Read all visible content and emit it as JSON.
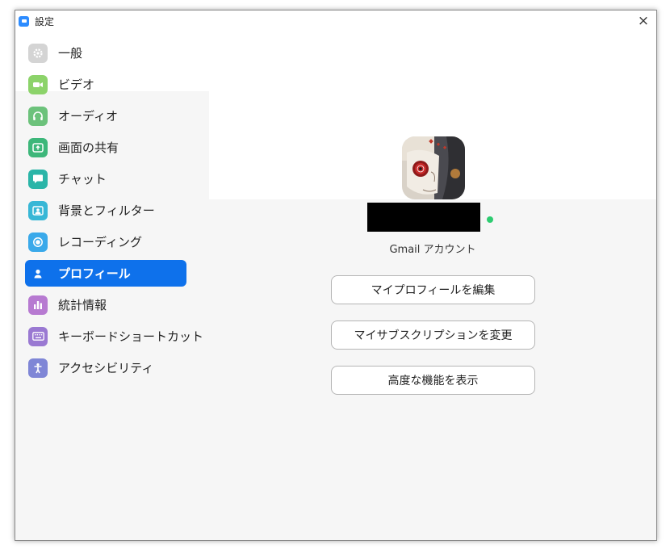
{
  "window": {
    "title": "設定",
    "close_label": "×"
  },
  "sidebar": {
    "items": [
      {
        "label": "一般",
        "icon": "gear-icon",
        "color": "#cfcfcf"
      },
      {
        "label": "ビデオ",
        "icon": "video-camera-icon",
        "color": "#8cd36a"
      },
      {
        "label": "オーディオ",
        "icon": "headphones-icon",
        "color": "#6cc27b"
      },
      {
        "label": "画面の共有",
        "icon": "share-screen-icon",
        "color": "#3db77a"
      },
      {
        "label": "チャット",
        "icon": "chat-bubble-icon",
        "color": "#2bb5a8"
      },
      {
        "label": "背景とフィルター",
        "icon": "background-image-icon",
        "color": "#38b7d6"
      },
      {
        "label": "レコーディング",
        "icon": "record-icon",
        "color": "#3aa9ea"
      },
      {
        "label": "プロフィール",
        "icon": "person-icon",
        "color": "#0e71eb",
        "active": true
      },
      {
        "label": "統計情報",
        "icon": "bar-chart-icon",
        "color": "#b77ad1"
      },
      {
        "label": "キーボードショートカット",
        "icon": "keyboard-icon",
        "color": "#9a79d2"
      },
      {
        "label": "アクセシビリティ",
        "icon": "accessibility-icon",
        "color": "#7f86d6"
      }
    ]
  },
  "profile": {
    "account_type": "Gmail アカウント",
    "status": "online",
    "status_color": "#2ecc71",
    "buttons": {
      "edit_profile": "マイプロフィールを編集",
      "subscription": "マイサブスクリプションを変更",
      "advanced": "高度な機能を表示"
    }
  }
}
